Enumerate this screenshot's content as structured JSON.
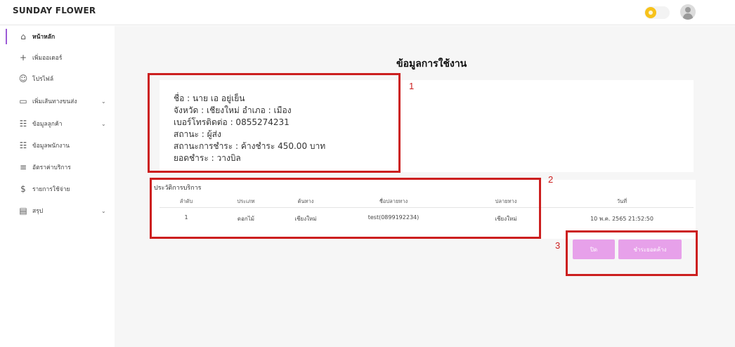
{
  "app": {
    "brand": "SUNDAY FLOWER"
  },
  "header": {
    "theme_toggle_icon": "sun-icon",
    "avatar_icon": "user-icon"
  },
  "sidebar": {
    "items": [
      {
        "label": "หน้าหลัก",
        "icon": "home-icon",
        "active": true,
        "has_children": false
      },
      {
        "label": "เพิ่มออเดอร์",
        "icon": "plus-icon",
        "active": false,
        "has_children": false
      },
      {
        "label": "โปรไฟล์",
        "icon": "user-icon",
        "active": false,
        "has_children": false
      },
      {
        "label": "เพิ่มเส้นทางขนส่ง",
        "icon": "truck-icon",
        "active": false,
        "has_children": true
      },
      {
        "label": "ข้อมูลลูกค้า",
        "icon": "users-icon",
        "active": false,
        "has_children": true
      },
      {
        "label": "ข้อมูลพนักงาน",
        "icon": "users-icon",
        "active": false,
        "has_children": false
      },
      {
        "label": "อัตราค่าบริการ",
        "icon": "list-icon",
        "active": false,
        "has_children": false
      },
      {
        "label": "รายการใช้จ่าย",
        "icon": "dollar-icon",
        "active": false,
        "has_children": false
      },
      {
        "label": "สรุป",
        "icon": "report-icon",
        "active": false,
        "has_children": true
      }
    ]
  },
  "main": {
    "title": "ข้อมูลการใช้งาน",
    "info": {
      "name": "ชื่อ : นาย เอ อยู่เย็น",
      "location": "จังหวัด : เชียงใหม่ อำเภอ : เมือง",
      "phone": "เบอร์โทรติดต่อ : 0855274231",
      "status": "สถานะ : ผู้ส่ง",
      "payment_status": "สถานะการชำระ : ค้างชำระ 450.00 บาท",
      "balance": "ยอดชำระ : วางบิล"
    },
    "history": {
      "title": "ประวัติการบริการ",
      "columns": [
        "ลำดับ",
        "ประเภท",
        "ต้นทาง",
        "ชื่อปลายทาง",
        "ปลายทาง",
        "วันที่"
      ],
      "rows": [
        [
          "1",
          "ดอกไม้",
          "เชียงใหม่",
          "test(0899192234)",
          "เชียงใหม่",
          "10 พ.ค. 2565 21:52:50"
        ]
      ]
    },
    "buttons": {
      "close": "ปิด",
      "pay_outstanding": "ชำระยอดค้าง"
    }
  },
  "annotations": [
    "1",
    "2",
    "3"
  ],
  "colors": {
    "accent": "#9c5bd6",
    "button": "#e7a1ea",
    "annotation": "#cc1f1f",
    "sun": "#f7c21a"
  }
}
